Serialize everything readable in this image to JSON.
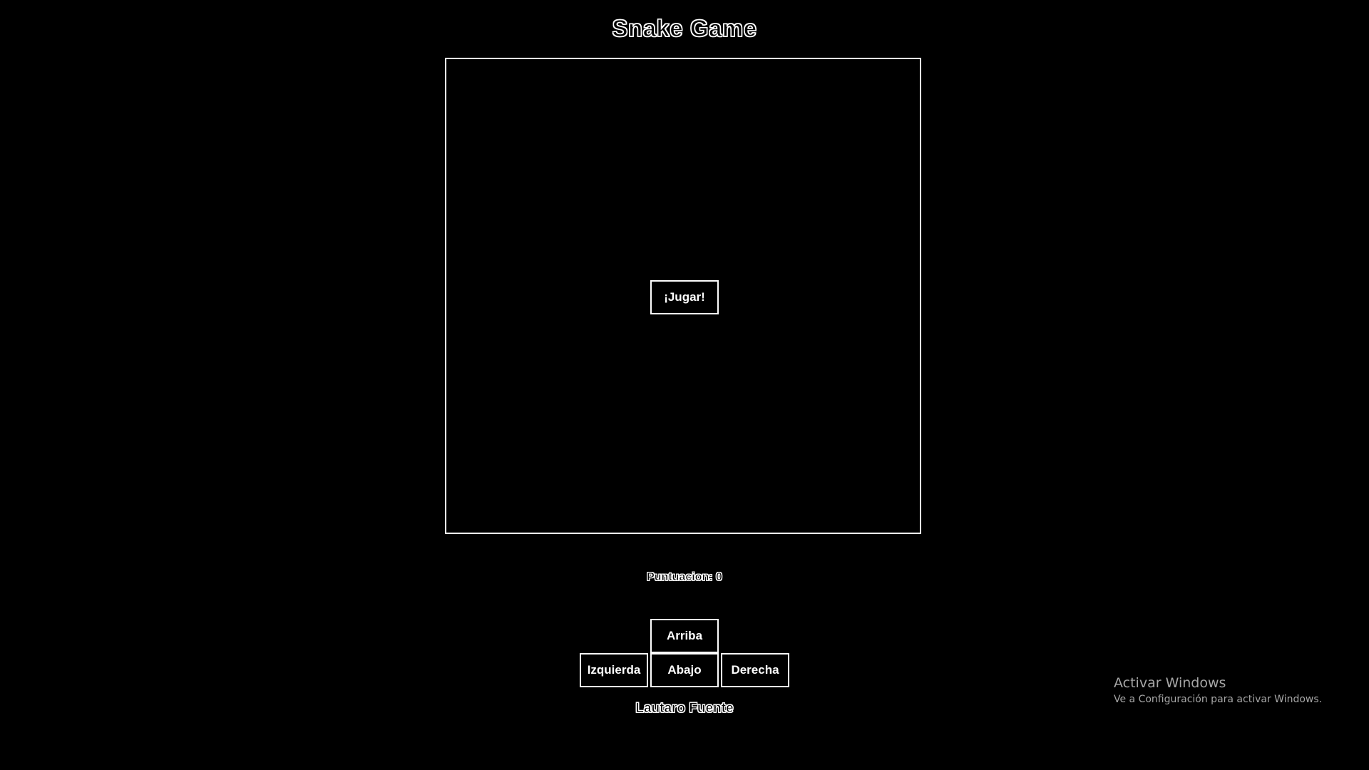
{
  "header": {
    "title": "Snake Game"
  },
  "board": {
    "play_label": "¡Jugar!"
  },
  "score": {
    "text": "Puntuacion: 0"
  },
  "controls": {
    "up": "Arriba",
    "left": "Izquierda",
    "down": "Abajo",
    "right": "Derecha"
  },
  "footer": {
    "author": "Lautaro Fuente"
  },
  "watermark": {
    "title": "Activar Windows",
    "subtitle": "Ve a Configuración para activar Windows."
  },
  "colors": {
    "background": "#000000",
    "foreground": "#ffffff",
    "watermark": "#a6a6a6"
  }
}
